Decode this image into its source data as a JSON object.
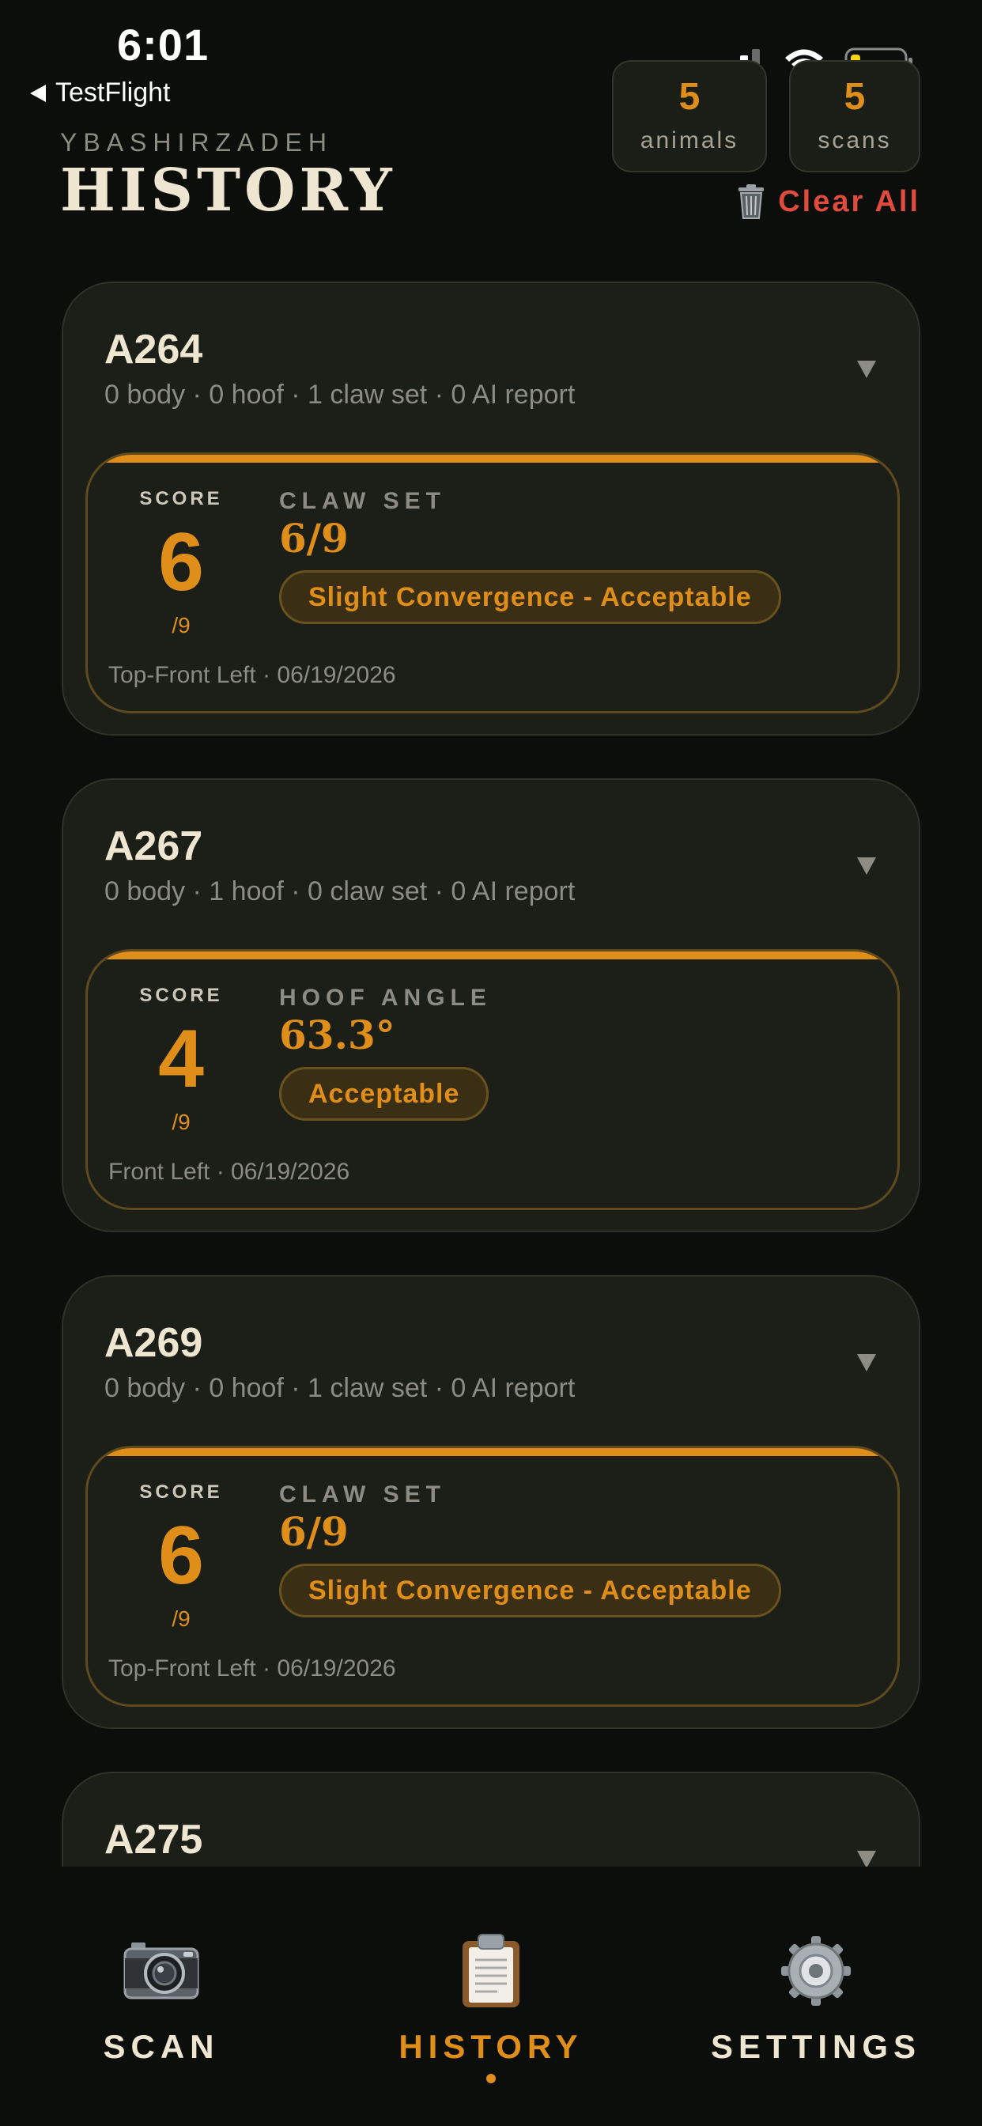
{
  "status_bar": {
    "time": "6:01",
    "back_app": "TestFlight"
  },
  "header": {
    "owner": "YBASHIRZADEH",
    "title": "HISTORY",
    "counters": [
      {
        "value": "5",
        "label": "animals"
      },
      {
        "value": "5",
        "label": "scans"
      }
    ],
    "clear_all": "Clear All"
  },
  "animals": [
    {
      "id": "A264",
      "summary": "0 body · 0 hoof · 1 claw set · 0 AI report",
      "scan": {
        "score_label": "SCORE",
        "score": "6",
        "score_max": "/9",
        "type": "CLAW SET",
        "value": "6/9",
        "badge": "Slight Convergence - Acceptable",
        "meta": "Top-Front Left · 06/19/2026"
      }
    },
    {
      "id": "A267",
      "summary": "0 body · 1 hoof · 0 claw set · 0 AI report",
      "scan": {
        "score_label": "SCORE",
        "score": "4",
        "score_max": "/9",
        "type": "HOOF ANGLE",
        "value": "63.3°",
        "badge": "Acceptable",
        "meta": "Front Left · 06/19/2026"
      }
    },
    {
      "id": "A269",
      "summary": "0 body · 0 hoof · 1 claw set · 0 AI report",
      "scan": {
        "score_label": "SCORE",
        "score": "6",
        "score_max": "/9",
        "type": "CLAW SET",
        "value": "6/9",
        "badge": "Slight Convergence - Acceptable",
        "meta": "Top-Front Left · 06/19/2026"
      }
    },
    {
      "id": "A275"
    }
  ],
  "tabs": [
    {
      "label": "SCAN",
      "icon": "camera-icon",
      "active": false
    },
    {
      "label": "HISTORY",
      "icon": "clipboard-icon",
      "active": true
    },
    {
      "label": "SETTINGS",
      "icon": "gear-icon",
      "active": false
    }
  ],
  "colors": {
    "background": "#0c0e0b",
    "card": "#1b1f18",
    "accent": "#e08e1a",
    "danger": "#e14b3d",
    "text": "#efe6d2",
    "muted": "#8d8c82"
  }
}
